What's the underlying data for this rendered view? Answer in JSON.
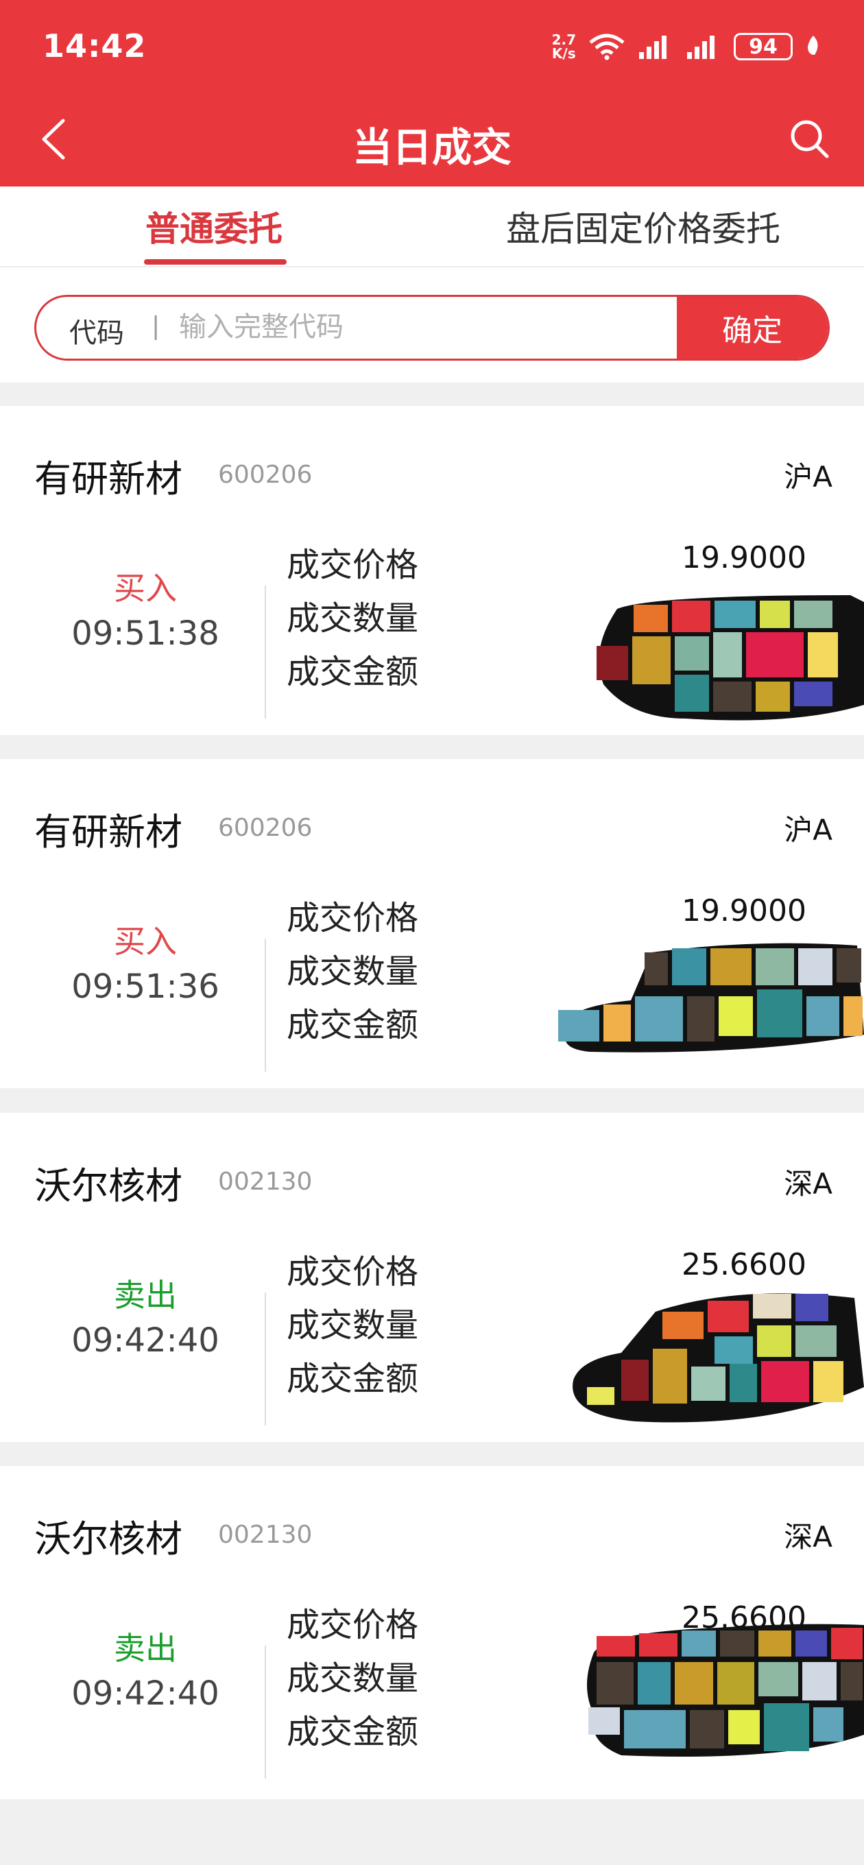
{
  "status_bar": {
    "time": "14:42",
    "net_speed_value": "2.7",
    "net_speed_unit": "K/s",
    "battery": "94"
  },
  "header": {
    "title": "当日成交"
  },
  "tabs": [
    {
      "label": "普通委托",
      "active": true
    },
    {
      "label": "盘后固定价格委托",
      "active": false
    }
  ],
  "search": {
    "label": "代码",
    "separator": "|",
    "placeholder": "输入完整代码",
    "value": "",
    "confirm": "确定"
  },
  "field_labels": {
    "price": "成交价格",
    "quantity": "成交数量",
    "amount": "成交金额"
  },
  "trades": [
    {
      "name": "有研新材",
      "code": "600206",
      "market": "沪A",
      "side": "买入",
      "side_type": "buy",
      "time": "09:51:38",
      "price": "19.9000"
    },
    {
      "name": "有研新材",
      "code": "600206",
      "market": "沪A",
      "side": "买入",
      "side_type": "buy",
      "time": "09:51:36",
      "price": "19.9000"
    },
    {
      "name": "沃尔核材",
      "code": "002130",
      "market": "深A",
      "side": "卖出",
      "side_type": "sell",
      "time": "09:42:40",
      "price": "25.6600"
    },
    {
      "name": "沃尔核材",
      "code": "002130",
      "market": "深A",
      "side": "卖出",
      "side_type": "sell",
      "time": "09:42:40",
      "price": "25.6600"
    }
  ],
  "colors": {
    "brand_red": "#e8373d",
    "buy": "#e0474c",
    "sell": "#1a9e2c"
  }
}
